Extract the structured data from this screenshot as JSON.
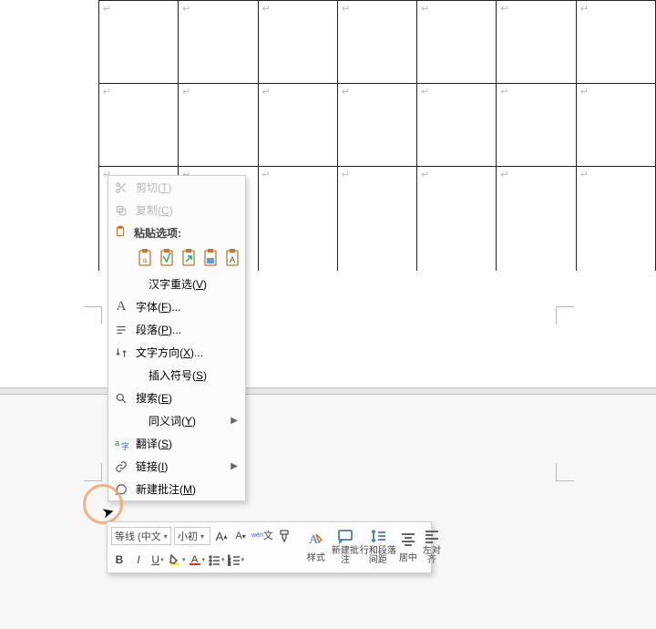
{
  "cell_mark": "↵",
  "context_menu": {
    "cut": {
      "label": "剪切",
      "accel": "(T)"
    },
    "copy": {
      "label": "复制",
      "accel": "(C)"
    },
    "paste_header": "粘贴选项:",
    "hanzi_reselect": {
      "label": "汉字重选",
      "accel": "(V)"
    },
    "font": {
      "label": "字体",
      "accel": "(F)",
      "suffix": "..."
    },
    "paragraph": {
      "label": "段落",
      "accel": "(P)",
      "suffix": "..."
    },
    "text_dir": {
      "label": "文字方向",
      "accel": "(X)",
      "suffix": "..."
    },
    "insert_symbol": {
      "label": "插入符号",
      "accel": "(S)"
    },
    "search": {
      "label": "搜索",
      "accel": "(E)"
    },
    "synonyms": {
      "label": "同义词",
      "accel": "(Y)"
    },
    "translate": {
      "label": "翻译",
      "accel": "(S)"
    },
    "link": {
      "label": "链接",
      "accel": "(I)"
    },
    "new_comment": {
      "label": "新建批注",
      "accel": "(M)"
    }
  },
  "mini_toolbar": {
    "font_name": "等线 (中文",
    "font_size": "小初",
    "bold": "B",
    "italic": "I",
    "underline": "U",
    "styles_label": "样式",
    "new_comment_label": "新建批注",
    "line_spacing_label": "行和段落间距",
    "center_label": "居中",
    "align_left_label": "左对齐"
  }
}
